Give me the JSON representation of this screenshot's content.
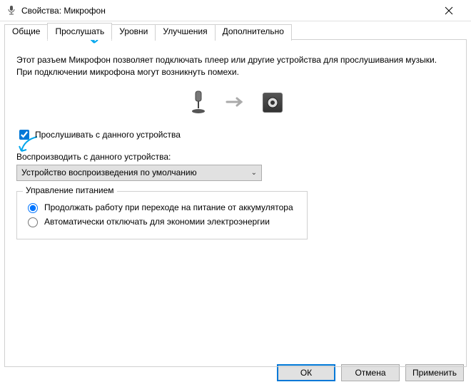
{
  "window": {
    "title": "Свойства: Микрофон"
  },
  "tabs": {
    "general": "Общие",
    "listen": "Прослушать",
    "levels": "Уровни",
    "enhancements": "Улучшения",
    "advanced": "Дополнительно"
  },
  "listenTab": {
    "description": "Этот разъем Микрофон позволяет подключать плеер или другие устройства для прослушивания музыки. При подключении микрофона могут возникнуть помехи.",
    "listenCheckbox": "Прослушивать с данного устройства",
    "playbackLabel": "Воспроизводить с данного устройства:",
    "playbackSelected": "Устройство воспроизведения по умолчанию",
    "power": {
      "legend": "Управление питанием",
      "keepOn": "Продолжать работу при переходе на питание от аккумулятора",
      "autoOff": "Автоматически отключать для экономии электроэнергии"
    }
  },
  "buttons": {
    "ok": "ОК",
    "cancel": "Отмена",
    "apply": "Применить"
  }
}
